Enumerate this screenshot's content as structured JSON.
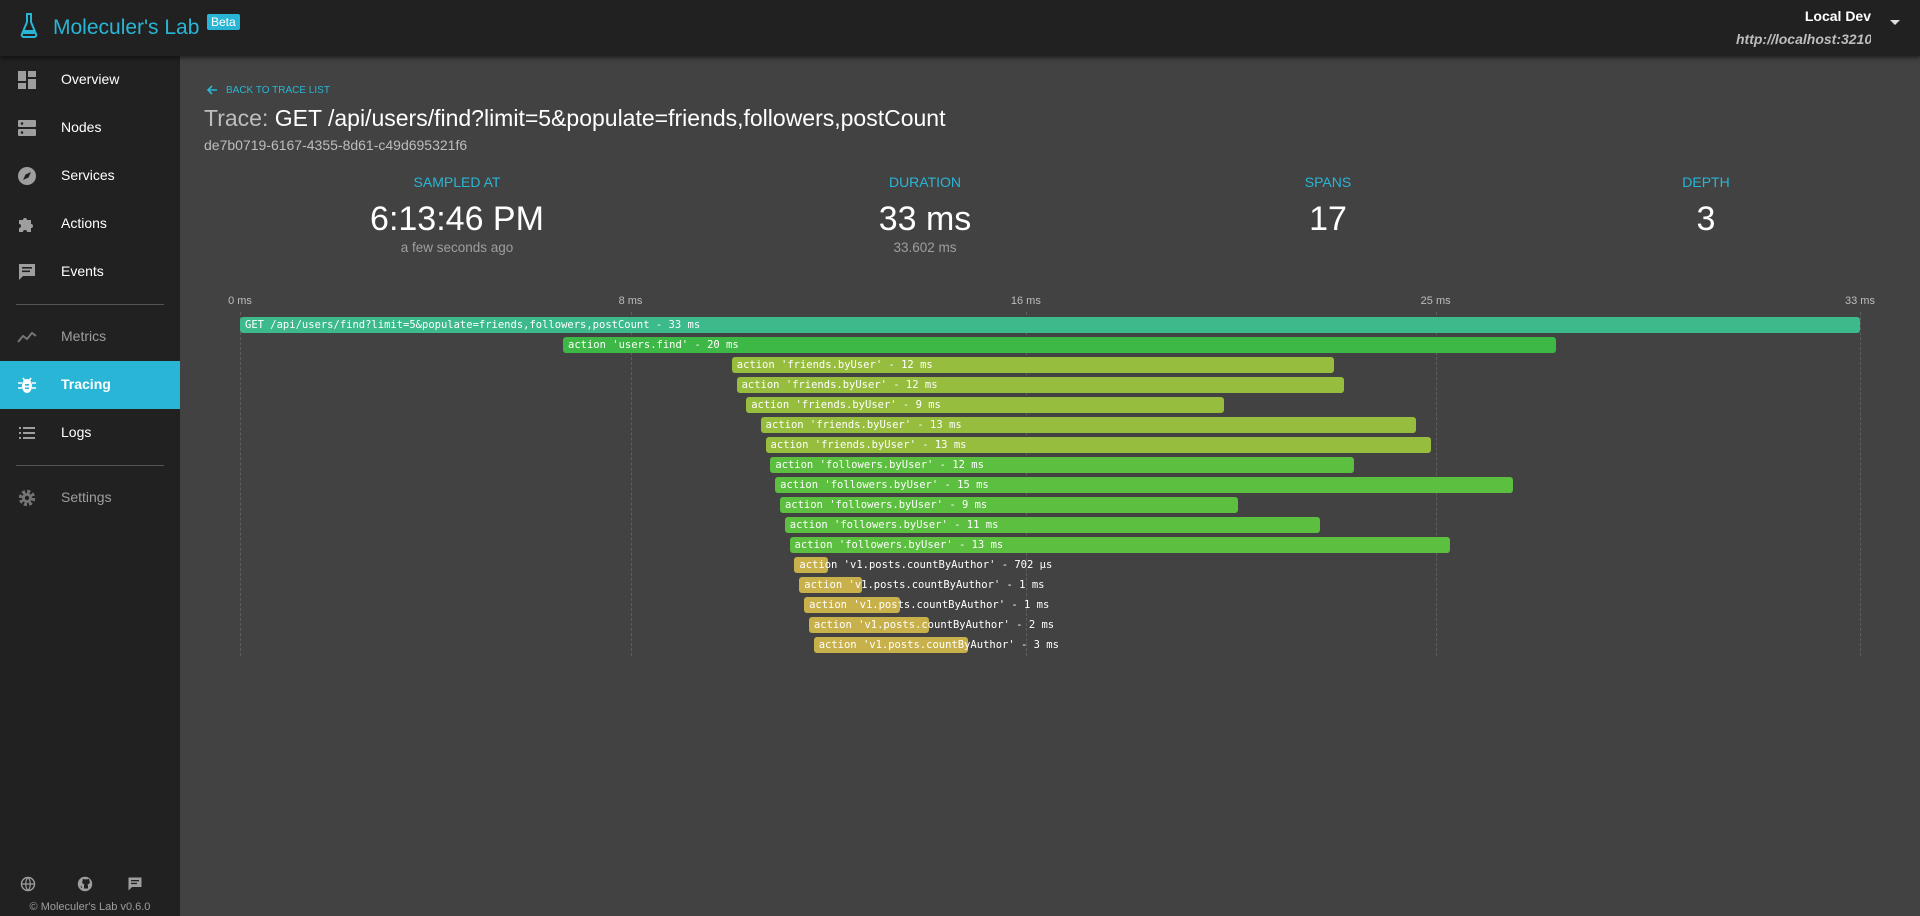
{
  "app": {
    "title": "Moleculer's Lab",
    "badge": "Beta"
  },
  "connection": {
    "name": "Local Dev",
    "url": "http://localhost:3210"
  },
  "nav": [
    {
      "label": "Overview",
      "icon": "dashboard-icon",
      "active": false
    },
    {
      "label": "Nodes",
      "icon": "server-icon",
      "active": false
    },
    {
      "label": "Services",
      "icon": "compass-icon",
      "active": false
    },
    {
      "label": "Actions",
      "icon": "puzzle-icon",
      "active": false
    },
    {
      "label": "Events",
      "icon": "message-icon",
      "active": false
    },
    {
      "label": "Metrics",
      "icon": "chart-line-icon",
      "active": false
    },
    {
      "label": "Tracing",
      "icon": "bug-icon",
      "active": true
    },
    {
      "label": "Logs",
      "icon": "list-icon",
      "active": false
    },
    {
      "label": "Settings",
      "icon": "gear-icon",
      "active": false
    }
  ],
  "footer": {
    "icons": [
      "globe-icon",
      "github-icon",
      "chat-icon"
    ],
    "copyright": "© Moleculer's Lab v0.6.0"
  },
  "trace": {
    "back_label": "Back to trace list",
    "title_prefix": "Trace:",
    "title": "GET /api/users/find?limit=5&populate=friends,followers,postCount",
    "id": "de7b0719-6167-4355-8d61-c49d695321f6"
  },
  "stats": [
    {
      "label": "Sampled at",
      "value": "6:13:46 PM",
      "sub": "a few seconds ago"
    },
    {
      "label": "Duration",
      "value": "33 ms",
      "sub": "33.602 ms"
    },
    {
      "label": "Spans",
      "value": "17",
      "sub": ""
    },
    {
      "label": "Depth",
      "value": "3",
      "sub": ""
    }
  ],
  "timeline": {
    "total_ms": 33.602,
    "ticks": [
      {
        "label": "0 ms",
        "ms": 0
      },
      {
        "label": "8 ms",
        "ms": 8.1
      },
      {
        "label": "16 ms",
        "ms": 16.3
      },
      {
        "label": "25 ms",
        "ms": 24.8
      },
      {
        "label": "33 ms",
        "ms": 33.602
      }
    ],
    "spans": [
      {
        "label": "GET /api/users/find?limit=5&populate=friends,followers,postCount - 33 ms",
        "start_ms": 0,
        "duration_ms": 33.602,
        "color": "#3dba8c"
      },
      {
        "label": "action 'users.find' - 20 ms",
        "start_ms": 6.7,
        "duration_ms": 20.6,
        "color": "#3db846"
      },
      {
        "label": "action 'friends.byUser' - 12 ms",
        "start_ms": 10.2,
        "duration_ms": 12.5,
        "color": "#97bd3f"
      },
      {
        "label": "action 'friends.byUser' - 12 ms",
        "start_ms": 10.3,
        "duration_ms": 12.6,
        "color": "#97bd3f"
      },
      {
        "label": "action 'friends.byUser' - 9 ms",
        "start_ms": 10.5,
        "duration_ms": 9.9,
        "color": "#97bd3f"
      },
      {
        "label": "action 'friends.byUser' - 13 ms",
        "start_ms": 10.8,
        "duration_ms": 13.6,
        "color": "#97bd3f"
      },
      {
        "label": "action 'friends.byUser' - 13 ms",
        "start_ms": 10.9,
        "duration_ms": 13.8,
        "color": "#97bd3f"
      },
      {
        "label": "action 'followers.byUser' - 12 ms",
        "start_ms": 11.0,
        "duration_ms": 12.1,
        "color": "#5cbf40"
      },
      {
        "label": "action 'followers.byUser' - 15 ms",
        "start_ms": 11.1,
        "duration_ms": 15.3,
        "color": "#5cbf40"
      },
      {
        "label": "action 'followers.byUser' - 9 ms",
        "start_ms": 11.2,
        "duration_ms": 9.5,
        "color": "#5cbf40"
      },
      {
        "label": "action 'followers.byUser' - 11 ms",
        "start_ms": 11.3,
        "duration_ms": 11.1,
        "color": "#5cbf40"
      },
      {
        "label": "action 'followers.byUser' - 13 ms",
        "start_ms": 11.4,
        "duration_ms": 13.7,
        "color": "#5cbf40"
      },
      {
        "label": "action 'v1.posts.countByAuthor' - 702 µs",
        "start_ms": 11.5,
        "duration_ms": 0.7,
        "color": "#c8b04a"
      },
      {
        "label": "action 'v1.posts.countByAuthor' - 1 ms",
        "start_ms": 11.6,
        "duration_ms": 1.3,
        "color": "#c8b04a"
      },
      {
        "label": "action 'v1.posts.countByAuthor' - 1 ms",
        "start_ms": 11.7,
        "duration_ms": 2.0,
        "color": "#c8b04a"
      },
      {
        "label": "action 'v1.posts.countByAuthor' - 2 ms",
        "start_ms": 11.8,
        "duration_ms": 2.5,
        "color": "#c8b04a"
      },
      {
        "label": "action 'v1.posts.countByAuthor' - 3 ms",
        "start_ms": 11.9,
        "duration_ms": 3.2,
        "color": "#c8b04a"
      }
    ]
  }
}
